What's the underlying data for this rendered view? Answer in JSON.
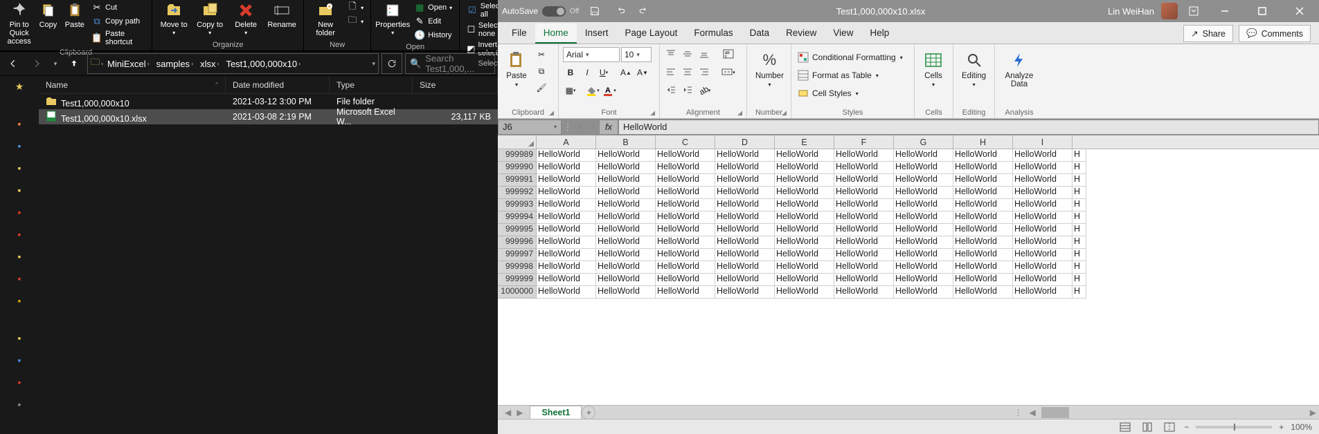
{
  "explorer": {
    "ribbon": {
      "pin": "Pin to Quick access",
      "copy": "Copy",
      "paste": "Paste",
      "cut": "Cut",
      "copyPath": "Copy path",
      "pasteShortcut": "Paste shortcut",
      "moveTo": "Move to",
      "copyTo": "Copy to",
      "delete": "Delete",
      "rename": "Rename",
      "newFolder": "New folder",
      "properties": "Properties",
      "open": "Open",
      "edit": "Edit",
      "history": "History",
      "selectAll": "Select all",
      "selectNone": "Select none",
      "invert": "Invert selection",
      "groups": {
        "clipboard": "Clipboard",
        "organize": "Organize",
        "new": "New",
        "open": "Open",
        "select": "Select"
      }
    },
    "breadcrumb": [
      "MiniExcel",
      "samples",
      "xlsx",
      "Test1,000,000x10"
    ],
    "searchPlaceholder": "Search Test1,000,...",
    "columns": {
      "name": "Name",
      "date": "Date modified",
      "type": "Type",
      "size": "Size"
    },
    "rows": [
      {
        "icon": "folder",
        "name": "Test1,000,000x10",
        "date": "2021-03-12 3:00 PM",
        "type": "File folder",
        "size": ""
      },
      {
        "icon": "xlsx",
        "name": "Test1,000,000x10.xlsx",
        "date": "2021-03-08 2:19 PM",
        "type": "Microsoft Excel W...",
        "size": "23,117 KB"
      }
    ]
  },
  "excel": {
    "autosave": "AutoSave",
    "autosaveState": "Off",
    "filename": "Test1,000,000x10.xlsx",
    "user": "Lin WeiHan",
    "tabs": [
      "File",
      "Home",
      "Insert",
      "Page Layout",
      "Formulas",
      "Data",
      "Review",
      "View",
      "Help"
    ],
    "activeTab": "Home",
    "share": "Share",
    "comments": "Comments",
    "ribbon": {
      "clipboard": {
        "paste": "Paste",
        "title": "Clipboard"
      },
      "font": {
        "name": "Arial",
        "size": "10",
        "title": "Font"
      },
      "alignment": {
        "title": "Alignment"
      },
      "number": {
        "label": "Number",
        "title": "Number"
      },
      "styles": {
        "cond": "Conditional Formatting",
        "table": "Format as Table",
        "cell": "Cell Styles",
        "title": "Styles"
      },
      "cells": {
        "label": "Cells",
        "title": "Cells"
      },
      "editing": {
        "label": "Editing",
        "title": "Editing"
      },
      "analysis": {
        "label": "Analyze Data",
        "title": "Analysis"
      }
    },
    "nameBox": "J6",
    "fxLabel": "fx",
    "formulaValue": "HelloWorld",
    "colHeaders": [
      "A",
      "B",
      "C",
      "D",
      "E",
      "F",
      "G",
      "H",
      "I"
    ],
    "rowHeaders": [
      "999989",
      "999990",
      "999991",
      "999992",
      "999993",
      "999994",
      "999995",
      "999996",
      "999997",
      "999998",
      "999999",
      "1000000"
    ],
    "cellValue": "HelloWorld",
    "partialCell": "H",
    "sheetTab": "Sheet1",
    "zoom": "100%"
  }
}
